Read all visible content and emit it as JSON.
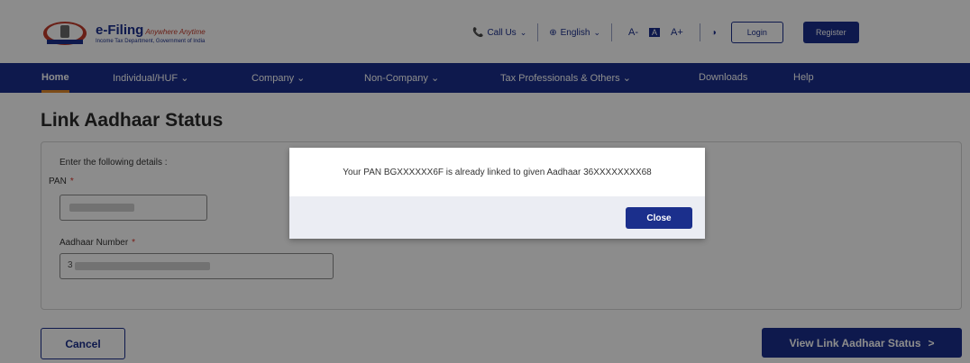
{
  "header": {
    "brand": "e-Filing",
    "tagline": "Anywhere Anytime",
    "department": "Income Tax Department, Government of India",
    "call_us": "Call Us",
    "language": "English",
    "font_decrease": "A-",
    "font_normal": "A",
    "font_increase": "A+",
    "login": "Login",
    "register": "Register"
  },
  "nav": {
    "items": [
      {
        "label": "Home"
      },
      {
        "label": "Individual/HUF"
      },
      {
        "label": "Company"
      },
      {
        "label": "Non-Company"
      },
      {
        "label": "Tax Professionals & Others"
      },
      {
        "label": "Downloads"
      },
      {
        "label": "Help"
      }
    ]
  },
  "page": {
    "title": "Link Aadhaar Status",
    "instructions": "Enter the following details :",
    "pan_label": "PAN",
    "aadhaar_label": "Aadhaar Number",
    "required_mark": "*",
    "aadhaar_prefix": "3",
    "cancel": "Cancel",
    "view_status": "View Link Aadhaar Status",
    "view_status_arrow": ">"
  },
  "modal": {
    "message": "Your PAN BGXXXXXX6F is already linked to given Aadhaar 36XXXXXXXX68",
    "close": "Close"
  },
  "colors": {
    "brand_blue": "#1b2f8c",
    "accent_orange": "#e38b2c",
    "required_red": "#d9342b"
  }
}
